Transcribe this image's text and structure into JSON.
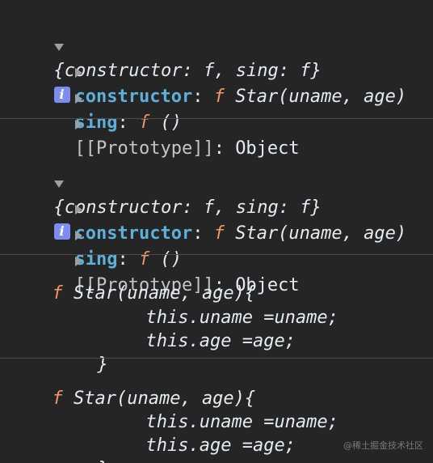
{
  "block1": {
    "summary_prefix": "{",
    "summary_key1": "constructor",
    "summary_sep1": ": ",
    "summary_val1": "f",
    "summary_comma": ", ",
    "summary_key2": "sing",
    "summary_sep2": ": ",
    "summary_val2": "f",
    "summary_suffix": "}",
    "info_label": "i",
    "prop1_key": "constructor",
    "prop1_colon": ":",
    "prop1_f": "f",
    "prop1_value": "Star(uname, age)",
    "prop2_key": "sing",
    "prop2_colon": ":",
    "prop2_f": "f",
    "prop2_value": "()",
    "prop3_key": "[[Prototype]]",
    "prop3_colon": ":",
    "prop3_value": "Object"
  },
  "block2": {
    "summary_prefix": "{",
    "summary_key1": "constructor",
    "summary_sep1": ": ",
    "summary_val1": "f",
    "summary_comma": ", ",
    "summary_key2": "sing",
    "summary_sep2": ": ",
    "summary_val2": "f",
    "summary_suffix": "}",
    "info_label": "i",
    "prop1_key": "constructor",
    "prop1_colon": ":",
    "prop1_f": "f",
    "prop1_value": "Star(uname, age)",
    "prop2_key": "sing",
    "prop2_colon": ":",
    "prop2_f": "f",
    "prop2_value": "()",
    "prop3_key": "[[Prototype]]",
    "prop3_colon": ":",
    "prop3_value": "Object"
  },
  "func1": {
    "f": "f",
    "signature": "Star(uname, age){",
    "line1": "this.uname =uname;",
    "line2": "this.age =age;",
    "close": "}"
  },
  "func2": {
    "f": "f",
    "signature": "Star(uname, age){",
    "line1": "this.uname =uname;",
    "line2": "this.age =age;",
    "close": "}"
  },
  "watermark": "@稀土掘金技术社区"
}
